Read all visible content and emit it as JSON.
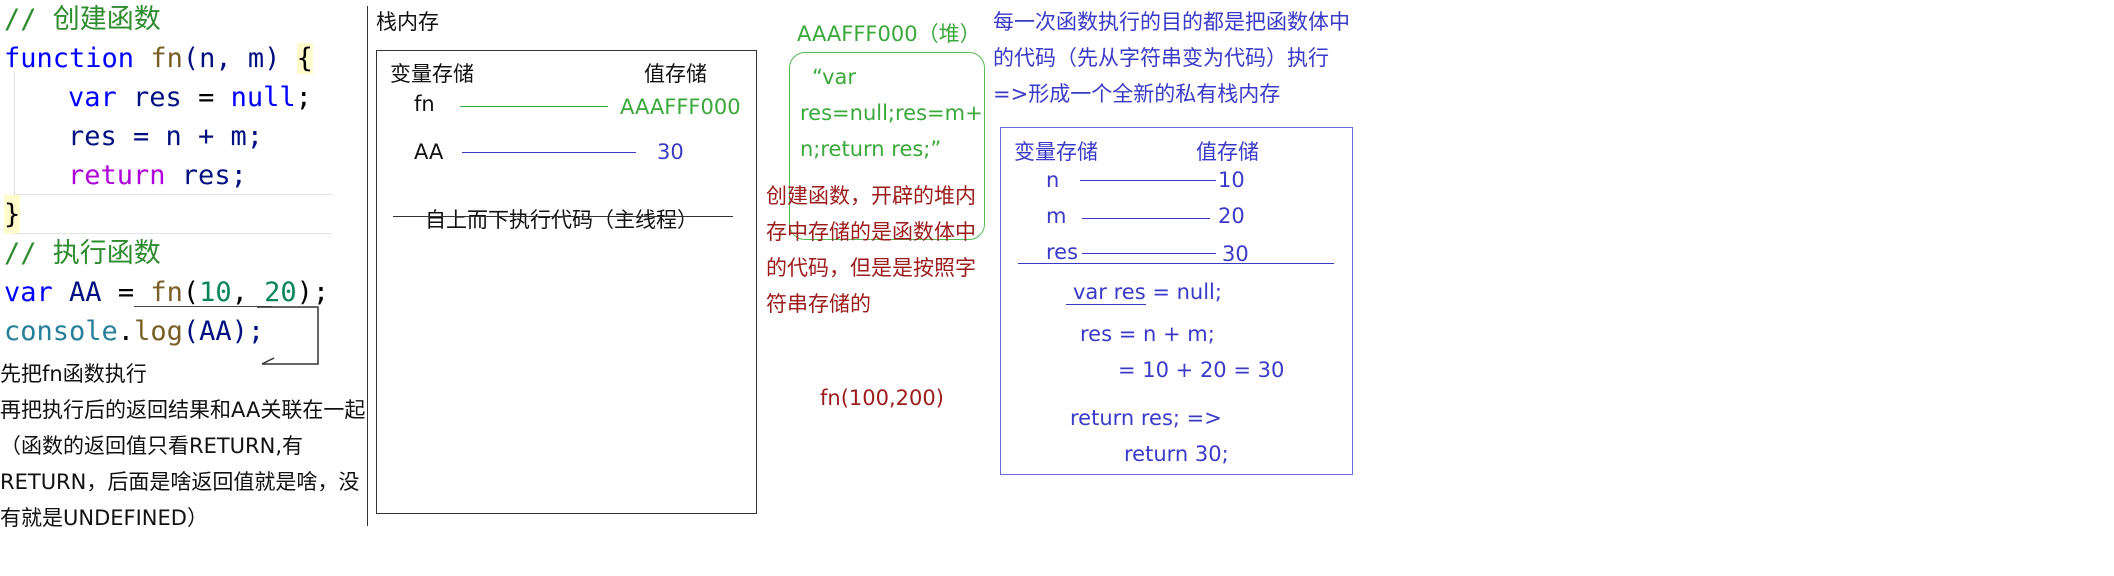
{
  "code": {
    "comment_create": "// 创建函数",
    "kw_function": "function",
    "fn_name": "fn",
    "params": "(n, m)",
    "brace_open": "{",
    "kw_var": "var",
    "res": "res",
    "eq": " = ",
    "kw_null": "null",
    "semi": ";",
    "line_assign": "res = n + m;",
    "kw_return": "return",
    "return_tail": " res;",
    "brace_close": "}",
    "comment_exec": "// 执行函数",
    "AA": "AA",
    "fn_call_open": "(",
    "arg1": "10",
    "comma": ", ",
    "arg2": "20",
    "call_close": ");",
    "console": "console",
    "dot": ".",
    "log": "log",
    "log_args": "(AA);"
  },
  "notes_left": {
    "line1": "先把fn函数执行",
    "line2": "再把执行后的返回结果和AA关联在一起",
    "line3": "（函数的返回值只看RETURN,有",
    "line4": "RETURN，后面是啥返回值就是啥，没",
    "line5": "有就是UNDEFINED）"
  },
  "stack": {
    "title": "栈内存",
    "var_header": "变量存储",
    "val_header": "值存储",
    "row1_var": "fn",
    "row1_val": "AAAFFF000",
    "row2_var": "AA",
    "row2_val": "30",
    "main_thread": "自上而下执行代码（主线程）"
  },
  "heap": {
    "address": "AAAFFF000（堆）",
    "body_line1": "“var",
    "body_line2": "res=null;res=m+",
    "body_line3": "n;return res;”",
    "note_line1": "创建函数，开辟的堆内",
    "note_line2": "存中存储的是函数体中",
    "note_line3": "的代码，但是是按照字",
    "note_line4": "符串存储的",
    "call_label": "fn(100,200)"
  },
  "private": {
    "desc_line1": "每一次函数执行的目的都是把函数体中",
    "desc_line2": "的代码（先从字符串变为代码）执行",
    "desc_line3": "=>形成一个全新的私有栈内存",
    "var_header": "变量存储",
    "val_header": "值存储",
    "row_n_var": "n",
    "row_n_val": "10",
    "row_m_var": "m",
    "row_m_val": "20",
    "row_res_var": "res",
    "row_res_val": "30",
    "exec1": "var res = null;",
    "exec2": "res = n + m;",
    "exec3": "= 10 + 20 = 30",
    "exec4": "return res;  =>",
    "exec5": "return 30;"
  },
  "colors": {
    "comment": "#2e8b2e",
    "keyword": "#0000ff",
    "return_kw": "#af00db",
    "function_name": "#795e26",
    "identifier": "#001080",
    "number": "#098658",
    "class": "#267f99",
    "blue_annotation": "#3a3ac8",
    "green_annotation": "#3aa83a",
    "red_annotation": "#9c1c1c"
  }
}
